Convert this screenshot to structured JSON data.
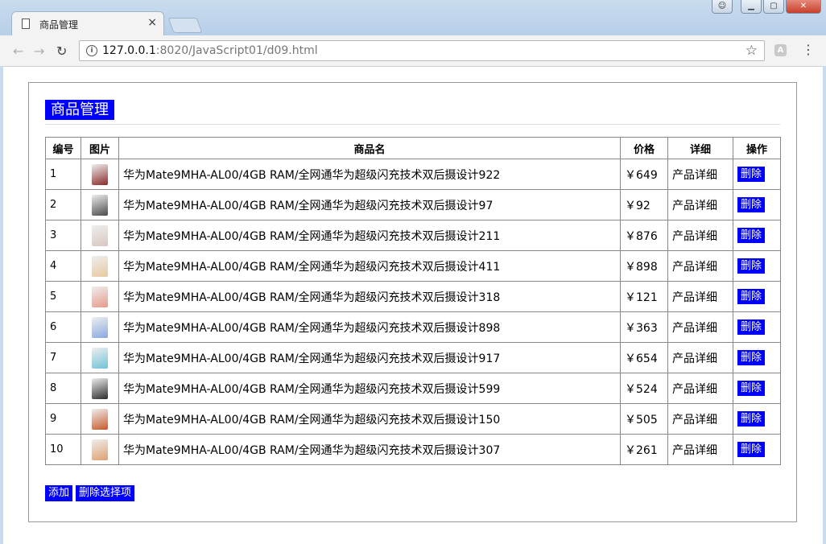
{
  "browser": {
    "tab_title": "商品管理",
    "tab_close": "×",
    "url_host": "127.0.0.1",
    "url_rest": ":8020/JavaScript01/d09.html",
    "icons": [
      "page-icon",
      "close-icon",
      "back-icon",
      "forward-icon",
      "reload-icon",
      "info-icon",
      "star-icon",
      "extension-icon",
      "menu-icon",
      "minimize-icon",
      "maximize-icon",
      "window-close-icon",
      "user-icon"
    ]
  },
  "page": {
    "heading": "商品管理",
    "accent_color": "#0000ff",
    "columns": [
      "编号",
      "图片",
      "商品名",
      "价格",
      "详细",
      "操作"
    ],
    "rows": [
      {
        "id": "1",
        "name": "华为Mate9MHA-AL00/4GB RAM/全网通华为超级闪充技术双后摄设计922",
        "price": "￥649",
        "detail": "产品详细",
        "action": "删除",
        "thumb_color": "#8a2a2a"
      },
      {
        "id": "2",
        "name": "华为Mate9MHA-AL00/4GB RAM/全网通华为超级闪充技术双后摄设计97",
        "price": "￥92",
        "detail": "产品详细",
        "action": "删除",
        "thumb_color": "#4a4a4a"
      },
      {
        "id": "3",
        "name": "华为Mate9MHA-AL00/4GB RAM/全网通华为超级闪充技术双后摄设计211",
        "price": "￥876",
        "detail": "产品详细",
        "action": "删除",
        "thumb_color": "#d9c7c0"
      },
      {
        "id": "4",
        "name": "华为Mate9MHA-AL00/4GB RAM/全网通华为超级闪充技术双后摄设计411",
        "price": "￥898",
        "detail": "产品详细",
        "action": "删除",
        "thumb_color": "#e8c9a0"
      },
      {
        "id": "5",
        "name": "华为Mate9MHA-AL00/4GB RAM/全网通华为超级闪充技术双后摄设计318",
        "price": "￥121",
        "detail": "产品详细",
        "action": "删除",
        "thumb_color": "#e79a8a"
      },
      {
        "id": "6",
        "name": "华为Mate9MHA-AL00/4GB RAM/全网通华为超级闪充技术双后摄设计898",
        "price": "￥363",
        "detail": "产品详细",
        "action": "删除",
        "thumb_color": "#8aa8e0"
      },
      {
        "id": "7",
        "name": "华为Mate9MHA-AL00/4GB RAM/全网通华为超级闪充技术双后摄设计917",
        "price": "￥654",
        "detail": "产品详细",
        "action": "删除",
        "thumb_color": "#6fc3d8"
      },
      {
        "id": "8",
        "name": "华为Mate9MHA-AL00/4GB RAM/全网通华为超级闪充技术双后摄设计599",
        "price": "￥524",
        "detail": "产品详细",
        "action": "删除",
        "thumb_color": "#2c2c2c"
      },
      {
        "id": "9",
        "name": "华为Mate9MHA-AL00/4GB RAM/全网通华为超级闪充技术双后摄设计150",
        "price": "￥505",
        "detail": "产品详细",
        "action": "删除",
        "thumb_color": "#c8582a"
      },
      {
        "id": "10",
        "name": "华为Mate9MHA-AL00/4GB RAM/全网通华为超级闪充技术双后摄设计307",
        "price": "￥261",
        "detail": "产品详细",
        "action": "删除",
        "thumb_color": "#e0a070"
      }
    ],
    "add_label": "添加",
    "delete_selected_label": "删除选择项"
  }
}
